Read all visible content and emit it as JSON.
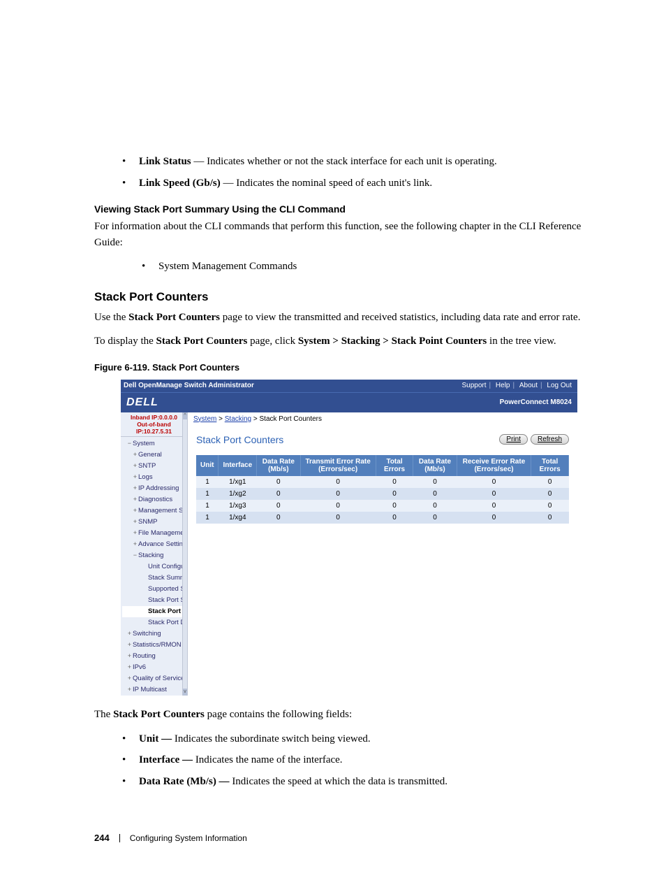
{
  "bullets_top": [
    {
      "term": "Link Status",
      "desc": " — Indicates whether or not the stack interface for each unit is operating."
    },
    {
      "term": "Link Speed (Gb/s)",
      "desc": " — Indicates the nominal speed of each unit's link."
    }
  ],
  "cli_heading": "Viewing Stack Port Summary Using the CLI Command",
  "cli_para": "For information about the CLI commands that perform this function, see the following chapter in the CLI Reference Guide:",
  "cli_bullet": "System Management Commands",
  "section_heading": "Stack Port Counters",
  "para1_pre": "Use the ",
  "para1_bold": "Stack Port Counters",
  "para1_post": " page to view the transmitted and received statistics, including data rate and error rate.",
  "para2_pre": "To display the ",
  "para2_b1": "Stack Port Counters",
  "para2_mid": " page, click ",
  "para2_b2": "System > Stacking > Stack Point Counters",
  "para2_post": " in the tree view.",
  "figure_caption": "Figure 6-119.    Stack Port Counters",
  "shot": {
    "topbar_title": "Dell OpenManage Switch Administrator",
    "links": [
      "Support",
      "Help",
      "About",
      "Log Out"
    ],
    "logo": "DELL",
    "product": "PowerConnect M8024",
    "ips": {
      "inband": "Inband IP:0.0.0.0",
      "oob": "Out-of-band IP:10.27.5.31"
    },
    "tree": [
      {
        "lvl": 0,
        "ex": "−",
        "label": "System"
      },
      {
        "lvl": 1,
        "ex": "+",
        "label": "General"
      },
      {
        "lvl": 1,
        "ex": "+",
        "label": "SNTP"
      },
      {
        "lvl": 1,
        "ex": "+",
        "label": "Logs"
      },
      {
        "lvl": 1,
        "ex": "+",
        "label": "IP Addressing"
      },
      {
        "lvl": 1,
        "ex": "+",
        "label": "Diagnostics"
      },
      {
        "lvl": 1,
        "ex": "+",
        "label": "Management Secur"
      },
      {
        "lvl": 1,
        "ex": "+",
        "label": "SNMP"
      },
      {
        "lvl": 1,
        "ex": "+",
        "label": "File Management"
      },
      {
        "lvl": 1,
        "ex": "+",
        "label": "Advance Settings"
      },
      {
        "lvl": 1,
        "ex": "−",
        "label": "Stacking"
      },
      {
        "lvl": 2,
        "ex": "",
        "label": "Unit Configuratio"
      },
      {
        "lvl": 2,
        "ex": "",
        "label": "Stack Summary"
      },
      {
        "lvl": 2,
        "ex": "",
        "label": "Supported Switc"
      },
      {
        "lvl": 2,
        "ex": "",
        "label": "Stack Port Sumr"
      },
      {
        "lvl": 2,
        "ex": "",
        "label": "Stack Port Cou",
        "sel": true
      },
      {
        "lvl": 2,
        "ex": "",
        "label": "Stack Port Diagn"
      },
      {
        "lvl": 0,
        "ex": "+",
        "label": "Switching"
      },
      {
        "lvl": 0,
        "ex": "+",
        "label": "Statistics/RMON"
      },
      {
        "lvl": 0,
        "ex": "+",
        "label": "Routing"
      },
      {
        "lvl": 0,
        "ex": "+",
        "label": "IPv6"
      },
      {
        "lvl": 0,
        "ex": "+",
        "label": "Quality of Service"
      },
      {
        "lvl": 0,
        "ex": "+",
        "label": "IP Multicast"
      }
    ],
    "crumbs": {
      "a": "System",
      "b": "Stacking",
      "c": "Stack Port Counters",
      "sep": " > "
    },
    "panel_title": "Stack Port Counters",
    "btn_print": "Print",
    "btn_refresh": "Refresh",
    "headers": [
      "Unit",
      "Interface",
      "Data Rate (Mb/s)",
      "Transmit Error Rate (Errors/sec)",
      "Total Errors",
      "Data Rate (Mb/s)",
      "Receive Error Rate (Errors/sec)",
      "Total Errors"
    ],
    "rows": [
      [
        "1",
        "1/xg1",
        "0",
        "0",
        "0",
        "0",
        "0",
        "0"
      ],
      [
        "1",
        "1/xg2",
        "0",
        "0",
        "0",
        "0",
        "0",
        "0"
      ],
      [
        "1",
        "1/xg3",
        "0",
        "0",
        "0",
        "0",
        "0",
        "0"
      ],
      [
        "1",
        "1/xg4",
        "0",
        "0",
        "0",
        "0",
        "0",
        "0"
      ]
    ]
  },
  "after_fig_pre": "The ",
  "after_fig_bold": "Stack Port Counters",
  "after_fig_post": " page contains the following fields:",
  "bullets_bottom": [
    {
      "term": "Unit — ",
      "desc": "Indicates the subordinate switch being viewed."
    },
    {
      "term": "Interface — ",
      "desc": "Indicates the name of the interface."
    },
    {
      "term": "Data Rate (Mb/s) — ",
      "desc": "Indicates the speed at which the data is transmitted."
    }
  ],
  "footer": {
    "page": "244",
    "chapter": "Configuring System Information"
  }
}
